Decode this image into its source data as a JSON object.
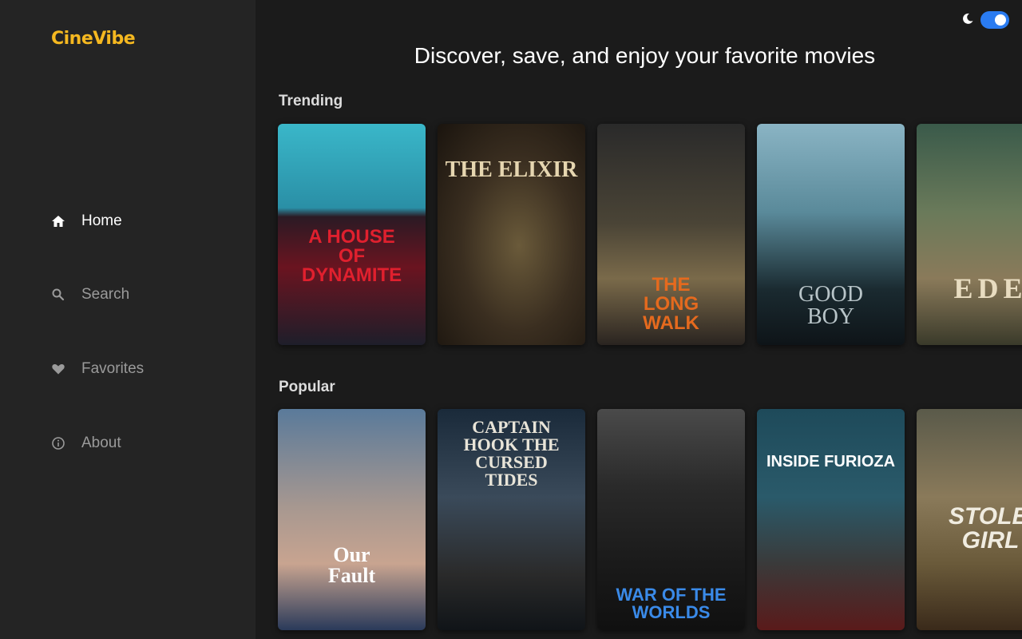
{
  "app": {
    "name": "CineVibe"
  },
  "sidebar": {
    "items": [
      {
        "label": "Home",
        "icon": "home-icon",
        "active": true
      },
      {
        "label": "Search",
        "icon": "search-icon",
        "active": false
      },
      {
        "label": "Favorites",
        "icon": "heart-icon",
        "active": false
      },
      {
        "label": "About",
        "icon": "info-icon",
        "active": false
      }
    ]
  },
  "header": {
    "headline": "Discover, save, and enjoy your favorite movies",
    "theme_toggle": {
      "mode": "dark",
      "enabled": true
    }
  },
  "sections": [
    {
      "title": "Trending",
      "movies": [
        {
          "title": "A HOUSE OF DYNAMITE"
        },
        {
          "title": "THE ELIXIR"
        },
        {
          "title": "THE LONG WALK"
        },
        {
          "title": "GOOD BOY"
        },
        {
          "title": "EDE"
        }
      ]
    },
    {
      "title": "Popular",
      "movies": [
        {
          "title": "Our Fault"
        },
        {
          "title": "CAPTAIN HOOK THE CURSED TIDES"
        },
        {
          "title": "WAR OF THE WORLDS"
        },
        {
          "title": "INSIDE FURIOZA"
        },
        {
          "title": "STOLEN GIRL"
        }
      ]
    }
  ],
  "colors": {
    "accent": "#f5b820",
    "toggle": "#2a7bf0",
    "sidebar_bg": "#242424",
    "main_bg": "#1b1b1b"
  }
}
